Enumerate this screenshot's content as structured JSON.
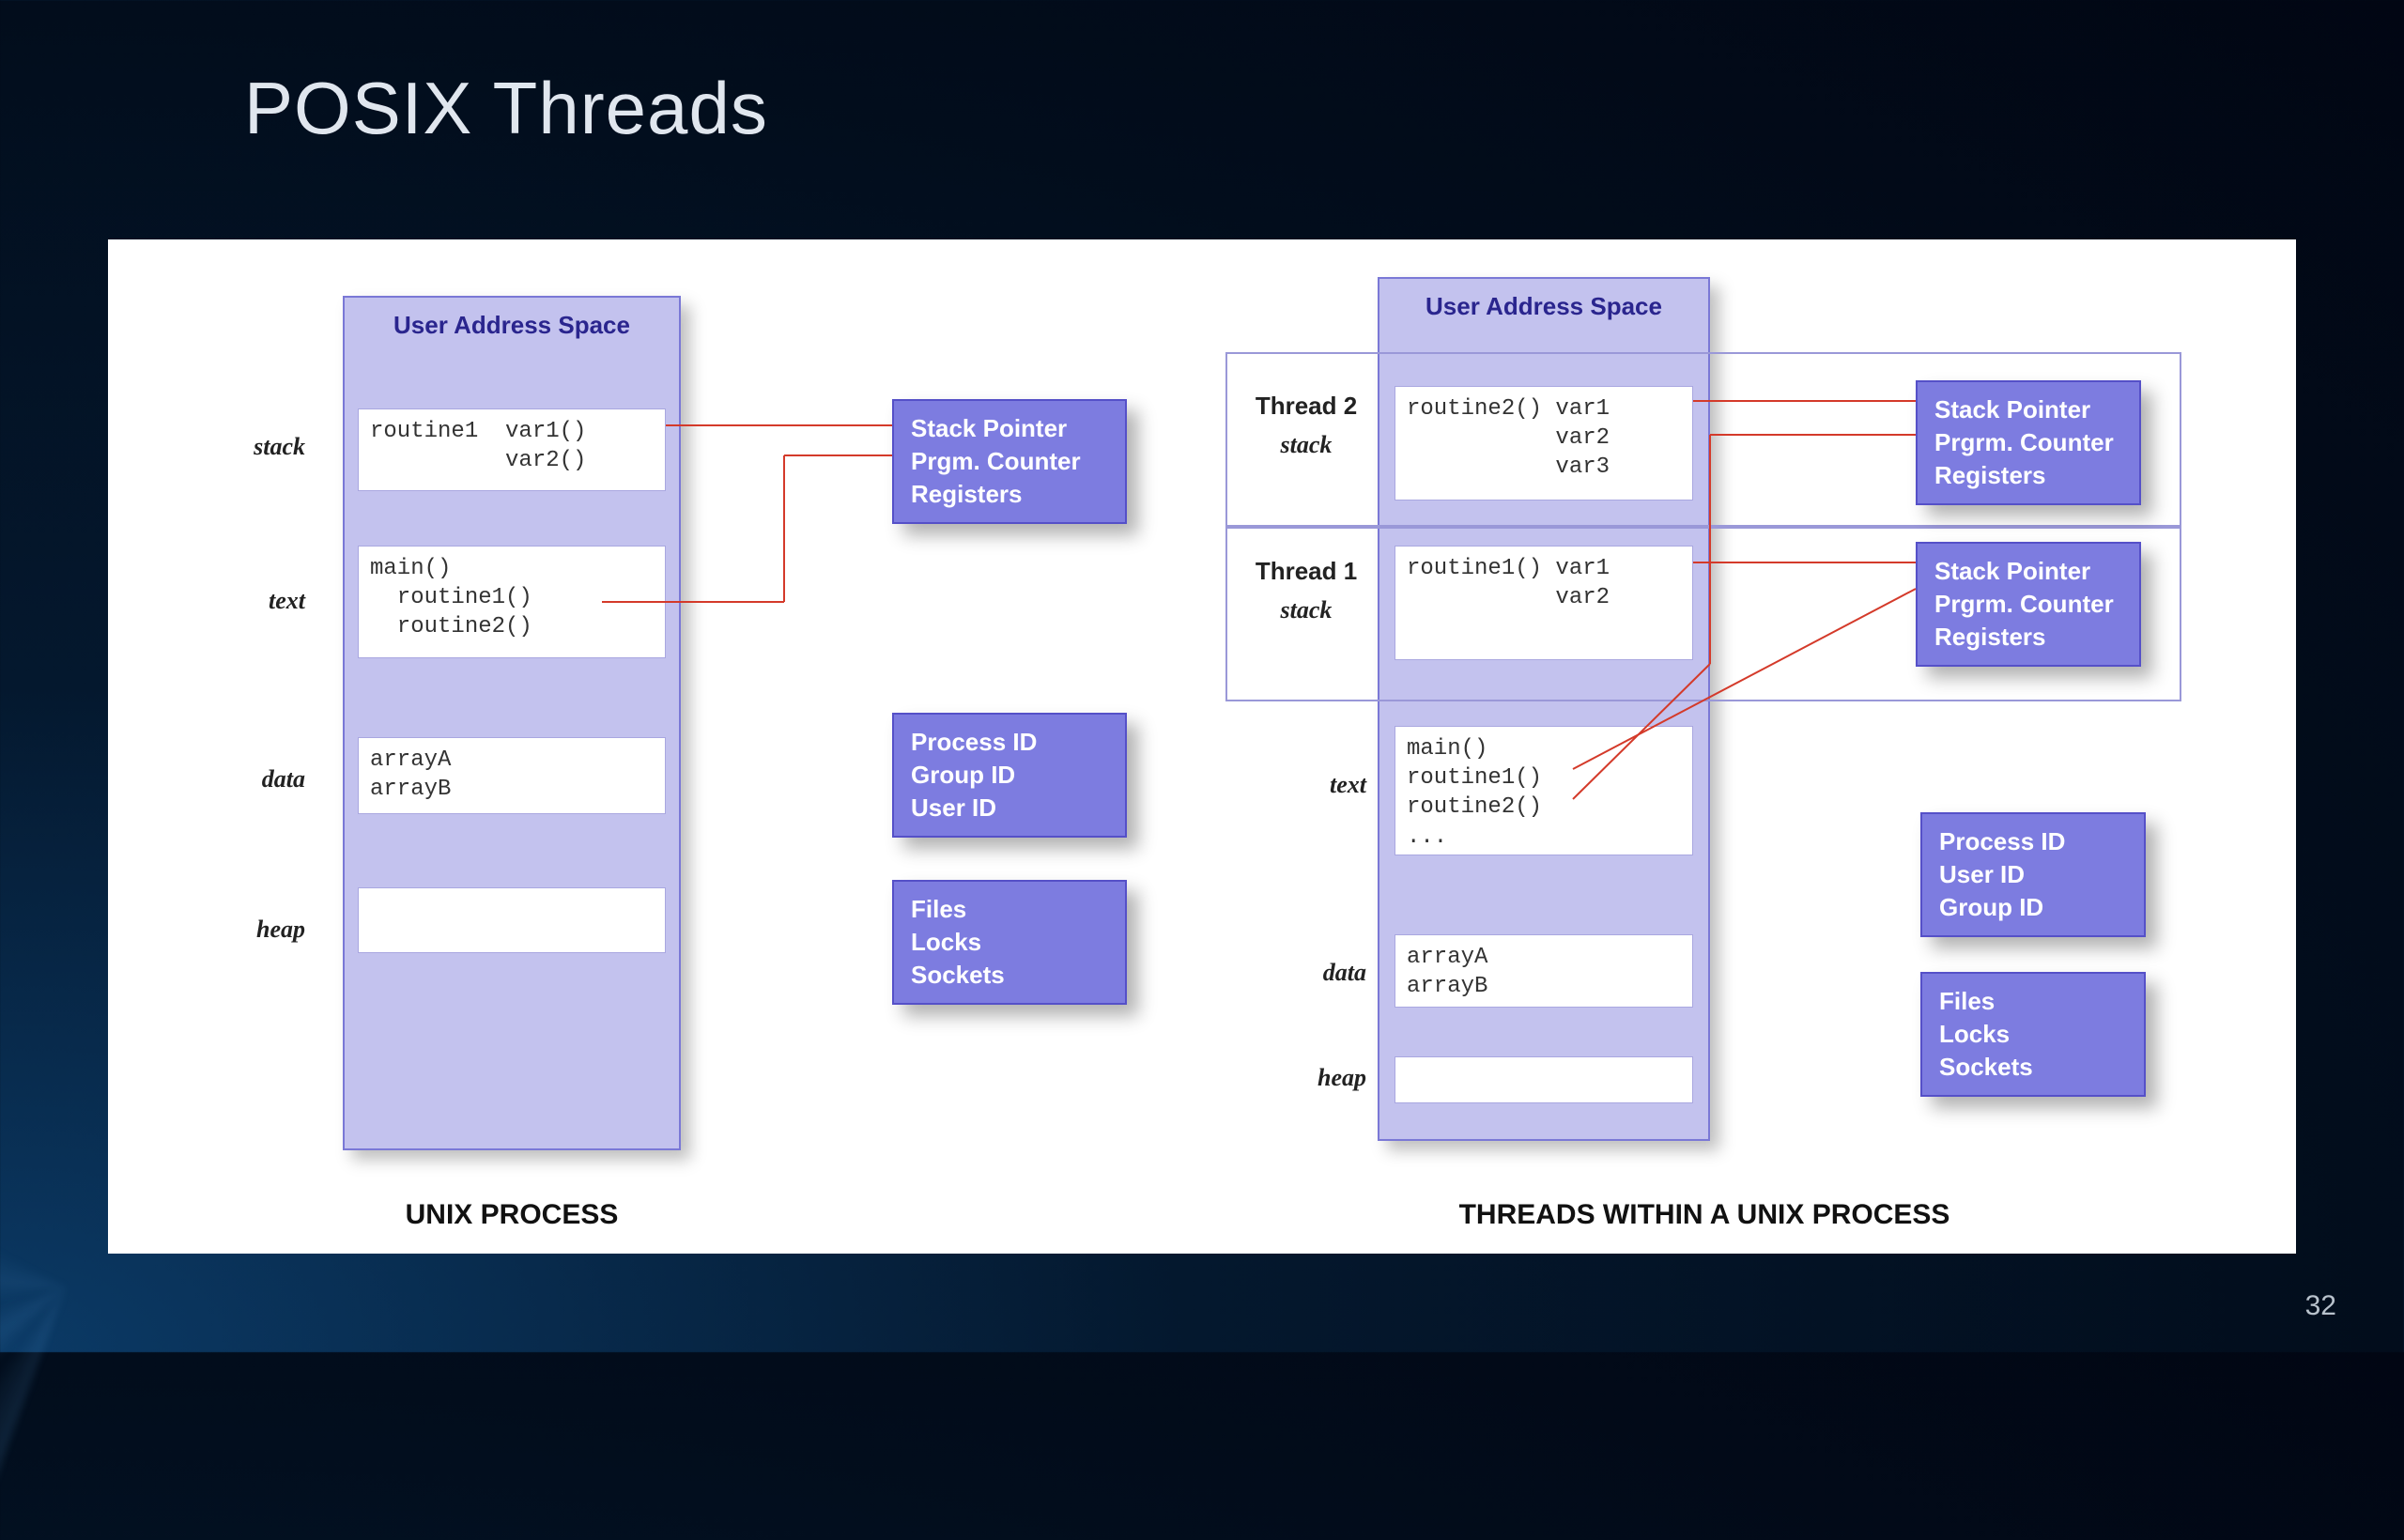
{
  "slide": {
    "title": "POSIX Threads",
    "number": "32"
  },
  "colors": {
    "background_dark": "#04182e",
    "panel_fill": "#c3c2ee",
    "panel_border": "#7a78d6",
    "info_fill": "#7d7ce0",
    "info_border": "#5550c8",
    "connector": "#d43a2a"
  },
  "diagram": {
    "left": {
      "caption": "UNIX PROCESS",
      "uas_header": "User Address Space",
      "segments": {
        "stack": {
          "label": "stack",
          "content": "routine1  var1()\n          var2()"
        },
        "text": {
          "label": "text",
          "content": "main()\n  routine1()\n  routine2()"
        },
        "data": {
          "label": "data",
          "content": "arrayA\narrayB"
        },
        "heap": {
          "label": "heap",
          "content": ""
        }
      },
      "info_boxes": {
        "regs": "Stack Pointer\nPrgm. Counter\nRegisters",
        "ids": "Process ID\nGroup ID\nUser ID",
        "files": "Files\nLocks\nSockets"
      }
    },
    "right": {
      "caption": "THREADS WITHIN A UNIX PROCESS",
      "uas_header": "User Address Space",
      "threads": [
        {
          "label": "Thread 2",
          "sublabel": "stack",
          "content": "routine2() var1\n           var2\n           var3"
        },
        {
          "label": "Thread 1",
          "sublabel": "stack",
          "content": "routine1() var1\n           var2"
        }
      ],
      "segments": {
        "text": {
          "label": "text",
          "content": "main()\nroutine1()\nroutine2()\n..."
        },
        "data": {
          "label": "data",
          "content": "arrayA\narrayB"
        },
        "heap": {
          "label": "heap",
          "content": ""
        }
      },
      "info_boxes": {
        "regs_t2": "Stack Pointer\nPrgrm. Counter\nRegisters",
        "regs_t1": "Stack Pointer\nPrgrm. Counter\nRegisters",
        "ids": "Process ID\nUser ID\nGroup ID",
        "files": "Files\nLocks\nSockets"
      }
    }
  }
}
